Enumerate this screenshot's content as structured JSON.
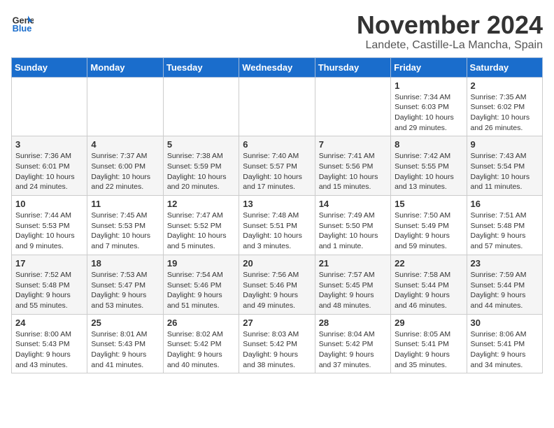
{
  "header": {
    "logo_general": "General",
    "logo_blue": "Blue",
    "month": "November 2024",
    "location": "Landete, Castille-La Mancha, Spain"
  },
  "weekdays": [
    "Sunday",
    "Monday",
    "Tuesday",
    "Wednesday",
    "Thursday",
    "Friday",
    "Saturday"
  ],
  "weeks": [
    [
      {
        "day": "",
        "info": ""
      },
      {
        "day": "",
        "info": ""
      },
      {
        "day": "",
        "info": ""
      },
      {
        "day": "",
        "info": ""
      },
      {
        "day": "",
        "info": ""
      },
      {
        "day": "1",
        "info": "Sunrise: 7:34 AM\nSunset: 6:03 PM\nDaylight: 10 hours and 29 minutes."
      },
      {
        "day": "2",
        "info": "Sunrise: 7:35 AM\nSunset: 6:02 PM\nDaylight: 10 hours and 26 minutes."
      }
    ],
    [
      {
        "day": "3",
        "info": "Sunrise: 7:36 AM\nSunset: 6:01 PM\nDaylight: 10 hours and 24 minutes."
      },
      {
        "day": "4",
        "info": "Sunrise: 7:37 AM\nSunset: 6:00 PM\nDaylight: 10 hours and 22 minutes."
      },
      {
        "day": "5",
        "info": "Sunrise: 7:38 AM\nSunset: 5:59 PM\nDaylight: 10 hours and 20 minutes."
      },
      {
        "day": "6",
        "info": "Sunrise: 7:40 AM\nSunset: 5:57 PM\nDaylight: 10 hours and 17 minutes."
      },
      {
        "day": "7",
        "info": "Sunrise: 7:41 AM\nSunset: 5:56 PM\nDaylight: 10 hours and 15 minutes."
      },
      {
        "day": "8",
        "info": "Sunrise: 7:42 AM\nSunset: 5:55 PM\nDaylight: 10 hours and 13 minutes."
      },
      {
        "day": "9",
        "info": "Sunrise: 7:43 AM\nSunset: 5:54 PM\nDaylight: 10 hours and 11 minutes."
      }
    ],
    [
      {
        "day": "10",
        "info": "Sunrise: 7:44 AM\nSunset: 5:53 PM\nDaylight: 10 hours and 9 minutes."
      },
      {
        "day": "11",
        "info": "Sunrise: 7:45 AM\nSunset: 5:53 PM\nDaylight: 10 hours and 7 minutes."
      },
      {
        "day": "12",
        "info": "Sunrise: 7:47 AM\nSunset: 5:52 PM\nDaylight: 10 hours and 5 minutes."
      },
      {
        "day": "13",
        "info": "Sunrise: 7:48 AM\nSunset: 5:51 PM\nDaylight: 10 hours and 3 minutes."
      },
      {
        "day": "14",
        "info": "Sunrise: 7:49 AM\nSunset: 5:50 PM\nDaylight: 10 hours and 1 minute."
      },
      {
        "day": "15",
        "info": "Sunrise: 7:50 AM\nSunset: 5:49 PM\nDaylight: 9 hours and 59 minutes."
      },
      {
        "day": "16",
        "info": "Sunrise: 7:51 AM\nSunset: 5:48 PM\nDaylight: 9 hours and 57 minutes."
      }
    ],
    [
      {
        "day": "17",
        "info": "Sunrise: 7:52 AM\nSunset: 5:48 PM\nDaylight: 9 hours and 55 minutes."
      },
      {
        "day": "18",
        "info": "Sunrise: 7:53 AM\nSunset: 5:47 PM\nDaylight: 9 hours and 53 minutes."
      },
      {
        "day": "19",
        "info": "Sunrise: 7:54 AM\nSunset: 5:46 PM\nDaylight: 9 hours and 51 minutes."
      },
      {
        "day": "20",
        "info": "Sunrise: 7:56 AM\nSunset: 5:46 PM\nDaylight: 9 hours and 49 minutes."
      },
      {
        "day": "21",
        "info": "Sunrise: 7:57 AM\nSunset: 5:45 PM\nDaylight: 9 hours and 48 minutes."
      },
      {
        "day": "22",
        "info": "Sunrise: 7:58 AM\nSunset: 5:44 PM\nDaylight: 9 hours and 46 minutes."
      },
      {
        "day": "23",
        "info": "Sunrise: 7:59 AM\nSunset: 5:44 PM\nDaylight: 9 hours and 44 minutes."
      }
    ],
    [
      {
        "day": "24",
        "info": "Sunrise: 8:00 AM\nSunset: 5:43 PM\nDaylight: 9 hours and 43 minutes."
      },
      {
        "day": "25",
        "info": "Sunrise: 8:01 AM\nSunset: 5:43 PM\nDaylight: 9 hours and 41 minutes."
      },
      {
        "day": "26",
        "info": "Sunrise: 8:02 AM\nSunset: 5:42 PM\nDaylight: 9 hours and 40 minutes."
      },
      {
        "day": "27",
        "info": "Sunrise: 8:03 AM\nSunset: 5:42 PM\nDaylight: 9 hours and 38 minutes."
      },
      {
        "day": "28",
        "info": "Sunrise: 8:04 AM\nSunset: 5:42 PM\nDaylight: 9 hours and 37 minutes."
      },
      {
        "day": "29",
        "info": "Sunrise: 8:05 AM\nSunset: 5:41 PM\nDaylight: 9 hours and 35 minutes."
      },
      {
        "day": "30",
        "info": "Sunrise: 8:06 AM\nSunset: 5:41 PM\nDaylight: 9 hours and 34 minutes."
      }
    ]
  ]
}
